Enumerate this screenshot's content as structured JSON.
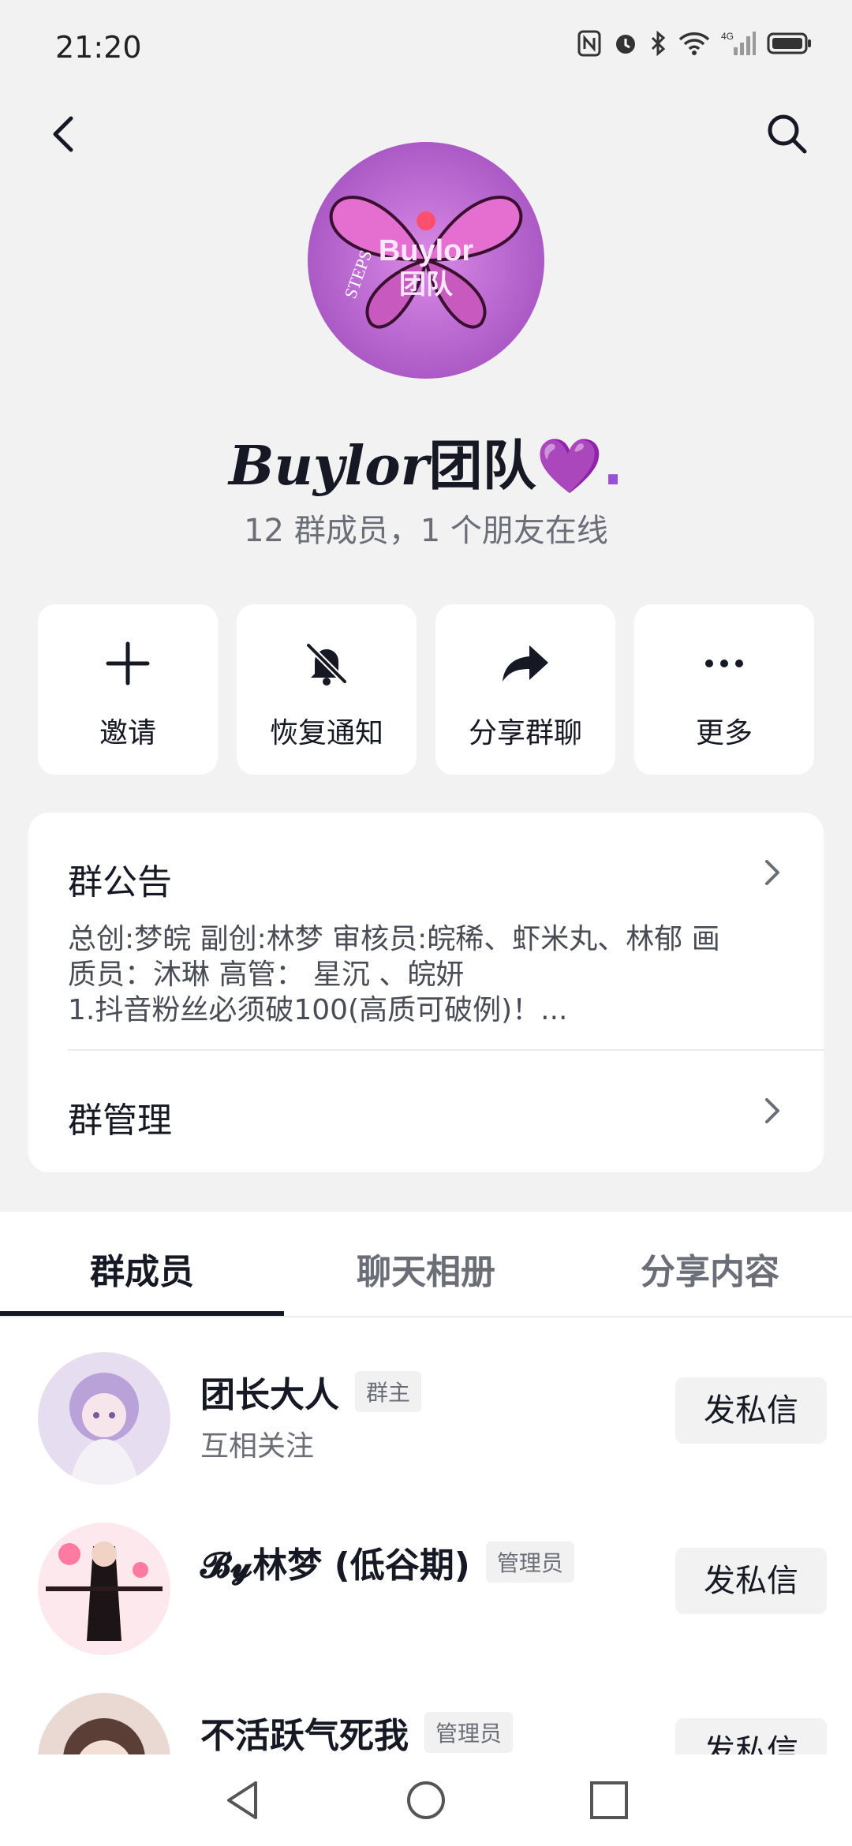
{
  "status": {
    "time": "21:20",
    "network": "4G"
  },
  "group": {
    "name_latin": "Buylor",
    "name_cjk": "团队",
    "name_suffix": "💜.",
    "subtitle": "12 群成员，1 个朋友在线",
    "avatar_text_main": "Buylor",
    "avatar_text_sub": "团队",
    "avatar_text_ring": "STEPS"
  },
  "actions": [
    {
      "label": "邀请",
      "icon": "plus-icon"
    },
    {
      "label": "恢复通知",
      "icon": "bell-off-icon"
    },
    {
      "label": "分享群聊",
      "icon": "share-arrow-icon"
    },
    {
      "label": "更多",
      "icon": "more-dots-icon"
    }
  ],
  "notice": {
    "title": "群公告",
    "lines": [
      "总创:梦皖 副创:林梦 审核员:皖稀、虾米丸、林郁  画",
      "质员：沐琳 高管：  星沉 、皖妍",
      "1.抖音粉丝必须破100(高质可破例)！..."
    ]
  },
  "management": {
    "title": "群管理"
  },
  "tabs": [
    "群成员",
    "聊天相册",
    "分享内容"
  ],
  "members": [
    {
      "name": "团长大人",
      "badge": "群主",
      "sub": "互相关注",
      "button": "发私信"
    },
    {
      "name": "𝓑𝔂林梦 (低谷期)",
      "badge": "管理员",
      "sub": "",
      "button": "发私信"
    },
    {
      "name": "不活跃气死我",
      "badge": "管理员",
      "sub": "",
      "button": "发私信"
    }
  ],
  "colors": {
    "accent": "#161823",
    "avatar_purple": "#b05ac8",
    "heart": "#9b4fd6"
  }
}
